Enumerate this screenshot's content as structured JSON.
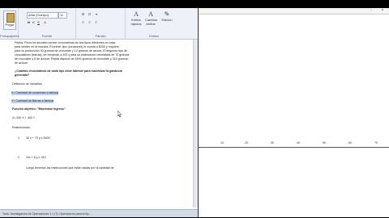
{
  "word": {
    "ribbon": {
      "paste_label": "Pegar",
      "font_name": "Arial (Cuerpo)",
      "font_size": "11",
      "groups": [
        "Portapapeles",
        "Fuente",
        "Párrafo",
        "Estilos"
      ],
      "styles": [
        {
          "glyph": "A",
          "label": "Estilos rápidos"
        },
        {
          "glyph": "A",
          "label": "Cambiar estilos"
        },
        {
          "glyph": "✎",
          "label": "Edición"
        }
      ]
    },
    "document": {
      "paragraph": [
        "Pepita: Pinos ha decidido vender chocolatinas de dos tipos diferentes en casa",
        "para vender en la escuela. El primer tipo (corazones) le cuesta a $200 y requiere",
        "para su producción 30 gramos de chocolate y 10 gramos de azúcar. El segundo tipo de",
        "chocolatines (barras), se venderán a 400 y para su elaboración necesitará de 70 gramos",
        "de chocolate y 8 de azúcar. Pepita dispone de 5400 gramos de chocolate y 310 gramos",
        "de azúcar."
      ],
      "question": [
        "¿Cuántas chocolatinas de cada tipo debe fabricar para maximizar la ganancia",
        "generada?"
      ],
      "var_heading": "Definición de Variables:",
      "var_x": "X= Cantidad de corazones a fabricar",
      "var_y": "Y= Cantidad de Barras a fabricar",
      "objective_heading": "Función objetivo: \"Maximizar Ingreso\"",
      "objective": "Z= 200 X + 400 Y",
      "restrictions_heading": "Restricciones:",
      "r1_num": "1.",
      "r1": "30 x + 70 y ≤ 5400",
      "r2_num": "2.",
      "r2": "10x + 8 y ≤ 310",
      "bottom_line": "Luego tenemos las restricciones que están dadas por la cantidad de"
    },
    "status": "Todo: Investigación de Operaciones 1.1 (7): Operadores para el Ap..."
  },
  "geogebra": {
    "x_ticks": [
      "10",
      "20",
      "30",
      "40",
      "50",
      "60",
      "70"
    ]
  }
}
